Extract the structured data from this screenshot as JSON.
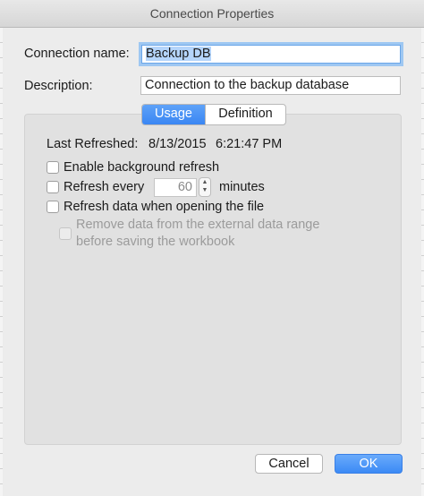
{
  "window": {
    "title": "Connection Properties"
  },
  "form": {
    "connection_name_label": "Connection name:",
    "connection_name_value": "Backup DB",
    "description_label": "Description:",
    "description_value": "Connection to the backup database"
  },
  "tabs": [
    {
      "label": "Usage",
      "selected": true
    },
    {
      "label": "Definition",
      "selected": false
    }
  ],
  "usage": {
    "last_refreshed_label": "Last Refreshed:",
    "last_refreshed_date": "8/13/2015",
    "last_refreshed_time": "6:21:47 PM",
    "enable_background_refresh": "Enable background refresh",
    "refresh_every_label": "Refresh every",
    "refresh_every_value": "60",
    "refresh_every_unit": "minutes",
    "refresh_on_open": "Refresh data when opening the file",
    "remove_data_line1": "Remove data from the external data range",
    "remove_data_line2": "before saving the workbook"
  },
  "buttons": {
    "cancel": "Cancel",
    "ok": "OK"
  },
  "colors": {
    "accent": "#3a86f3",
    "selection": "#b5d5fb",
    "focus_ring": "#9ec7f2"
  }
}
